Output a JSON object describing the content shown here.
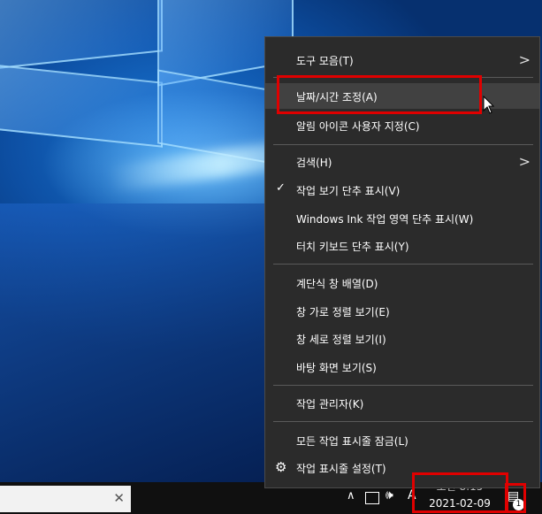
{
  "menu": {
    "items": [
      {
        "label": "도구 모음(T)",
        "submenu": true
      },
      {
        "label": "날짜/시간 조정(A)"
      },
      {
        "label": "알림 아이콘 사용자 지정(C)"
      },
      {
        "label": "검색(H)",
        "submenu": true
      },
      {
        "label": "작업 보기 단추 표시(V)",
        "checked": true
      },
      {
        "label": "Windows Ink 작업 영역 단추 표시(W)"
      },
      {
        "label": "터치 키보드 단추 표시(Y)"
      },
      {
        "label": "계단식 창 배열(D)"
      },
      {
        "label": "창 가로 정렬 보기(E)"
      },
      {
        "label": "창 세로 정렬 보기(I)"
      },
      {
        "label": "바탕 화면 보기(S)"
      },
      {
        "label": "작업 관리자(K)"
      },
      {
        "label": "모든 작업 표시줄 잠금(L)"
      },
      {
        "label": "작업 표시줄 설정(T)",
        "icon": "gear-icon"
      }
    ],
    "chevron": ">",
    "check": "✓",
    "gear": "⚙"
  },
  "taskbar": {
    "search_close": "✕",
    "tray_chevron": "∧",
    "volume": "🕪",
    "ime": "A",
    "clock_time": "오전 8:15",
    "clock_date": "2021-02-09",
    "notif_icon": "▤",
    "notif_count": "1"
  }
}
